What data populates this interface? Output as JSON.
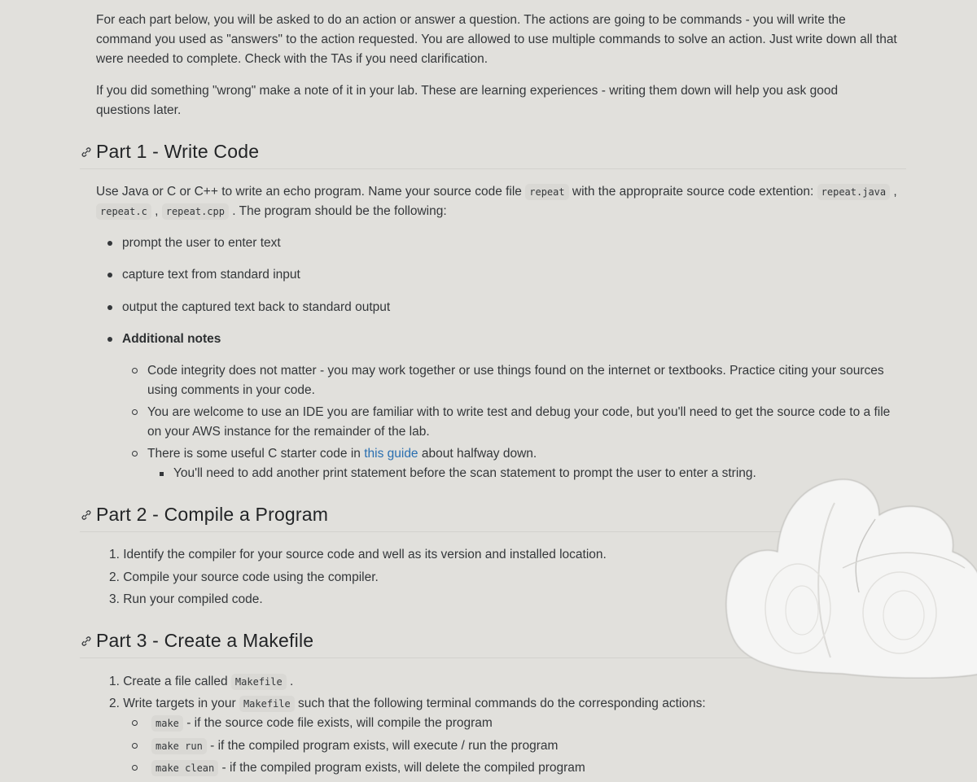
{
  "intro": {
    "paragraph1": "For each part below, you will be asked to do an action or answer a question. The actions are going to be commands - you will write the command you used as \"answers\" to the action requested. You are allowed to use multiple commands to solve an action. Just write down all that were needed to complete. Check with the TAs if you need clarification.",
    "paragraph1_lines": [
      "For each part below, you will be asked to do an action or answer a question. The actions are going to be commands - you will write the",
      "command you used as \"answers\" to the action requested. You are allowed to use multiple commands to solve an action. Just write down all that",
      "were needed to complete. Check with the TAs if you need clarification."
    ],
    "paragraph2_lines": [
      "If you did something \"wrong\" make a note of it in your lab. These are learning experiences - writing them down will help you ask good",
      "questions later."
    ]
  },
  "part1": {
    "heading": "Part 1 - Write Code",
    "anchor_icon": "link-icon",
    "desc": {
      "text_a": "Use Java or C or C++ to write an echo program. Name your source code file ",
      "code_a": "repeat",
      "text_b": " with the appropraite source code extention: ",
      "code_b": "repeat.java",
      "text_c": " ,",
      "code_c": "repeat.c",
      "text_d": " , ",
      "code_d": "repeat.cpp",
      "text_e": " . The program should be the following:"
    },
    "bullets": [
      "prompt the user to enter text",
      "capture text from standard input",
      "output the captured text back to standard output",
      "Additional notes"
    ],
    "notes": [
      {
        "lines": [
          "Code integrity does not matter - you may work together or use things found on the internet or textbooks. Practice citing your sources",
          "using comments in your code."
        ]
      },
      {
        "lines": [
          "You are welcome to use an IDE you are familiar with to write test and debug your code, but you'll need to get the source code to a file",
          "on your AWS instance for the remainder of the lab."
        ]
      },
      {
        "text_a": "There is some useful C starter code in ",
        "link": "this guide",
        "text_b": " about halfway down."
      }
    ],
    "subnote": "You'll need to add another print statement before the scan statement to prompt the user to enter a string."
  },
  "part2": {
    "heading": "Part 2 - Compile a Program",
    "anchor_icon": "link-icon",
    "steps": [
      "1. Identify the compiler for your source code and well as its version and installed location.",
      "2. Compile your source code using the compiler.",
      "3. Run your compiled code."
    ]
  },
  "part3": {
    "heading": "Part 3 - Create a Makefile",
    "anchor_icon": "link-icon",
    "step1": {
      "text_a": "1. Create a file called ",
      "code": "Makefile",
      "text_b": " ."
    },
    "step2": {
      "text_a": "2. Write targets in your ",
      "code": "Makefile",
      "text_b": " such that the following terminal commands do the corresponding actions:"
    },
    "targets": [
      {
        "command": "make",
        "desc": " - if the source code file exists, will compile the program"
      },
      {
        "command": "make run",
        "desc": " - if the compiled program exists, will execute / run the program"
      },
      {
        "command": "make clean",
        "desc": " - if the compiled program exists, will delete the compiled program"
      }
    ]
  },
  "overlay": {
    "cloud_icon": "cloud-sticker-icon"
  },
  "colors": {
    "background": "#e1e0dc",
    "text": "#34373a",
    "heading": "#222426",
    "link": "#2a6fb0",
    "code_bg": "#d9d8d4"
  }
}
